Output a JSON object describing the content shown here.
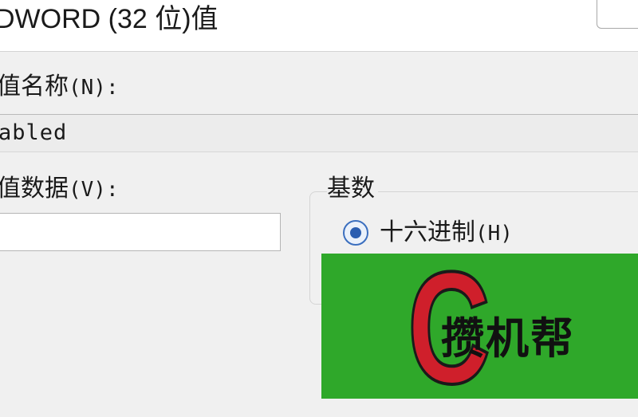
{
  "dialog": {
    "title": "DWORD (32 位)值",
    "value_name_label": "值名称",
    "value_name_accel": "(N):",
    "value_name": "abled",
    "value_data_label": "值数据",
    "value_data_accel": "(V):",
    "value_data": "",
    "radix": {
      "legend": "基数",
      "hex_label": "十六进制",
      "hex_accel": "(H)",
      "hex_selected": true
    }
  },
  "watermark": {
    "letter": "C",
    "text": "攒机帮",
    "colors": {
      "background": "#2fa82a",
      "letter": "#cf1f2b",
      "text": "#111111"
    }
  },
  "colors": {
    "accent": "#2a5db0",
    "window": "#f0f0f0"
  }
}
